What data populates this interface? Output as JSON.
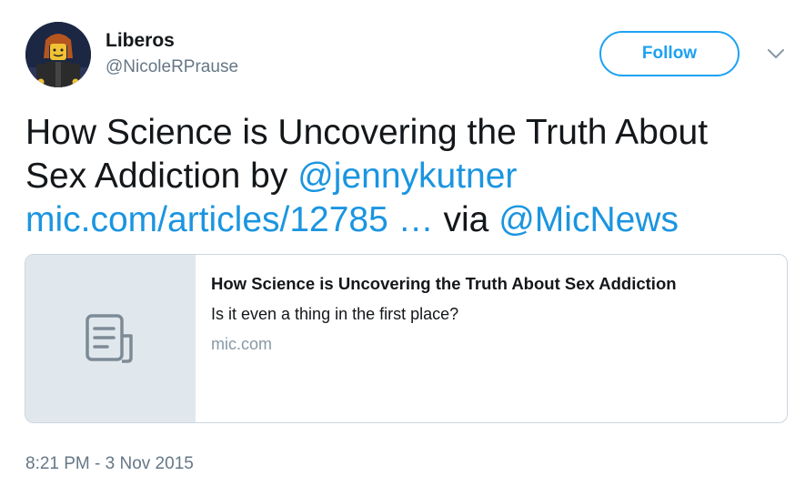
{
  "author": {
    "display_name": "Liberos",
    "handle": "@NicoleRPrause",
    "avatar_icon": "lego-figure-avatar"
  },
  "follow_label": "Follow",
  "menu_icon": "chevron-down-icon",
  "tweet": {
    "text_parts": {
      "line1": "How Science is Uncovering the Truth About",
      "line2_prefix": "Sex Addiction by ",
      "mention1": "@jennykutner",
      "link": "mic.com/articles/12785",
      "ellipsis": " … ",
      "via": "via ",
      "mention2": "@MicNews"
    }
  },
  "card": {
    "title": "How Science is Uncovering the Truth About Sex Addiction",
    "description": "Is it even a thing in the first place?",
    "domain": "mic.com",
    "icon": "document-icon"
  },
  "timestamp": "8:21 PM - 3 Nov 2015",
  "colors": {
    "accent": "#1da1f2",
    "link": "#1b95e0",
    "text": "#14171a",
    "muted": "#657786",
    "card_media_bg": "#e1e8ed"
  }
}
